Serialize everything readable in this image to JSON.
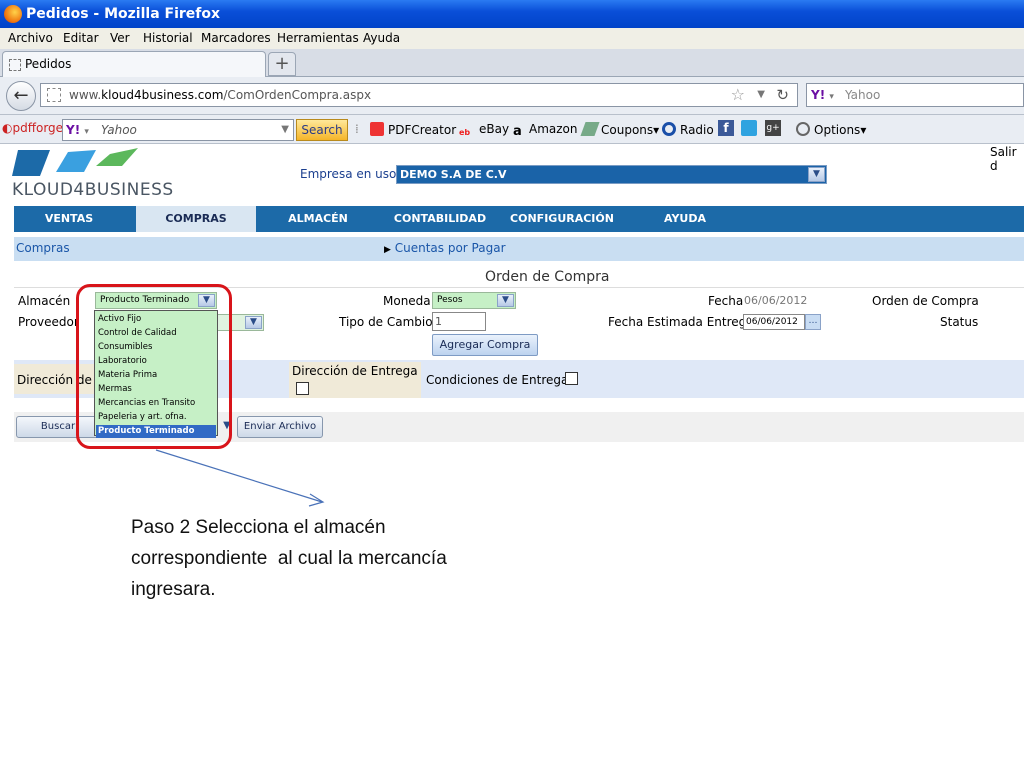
{
  "window": {
    "title": "Pedidos - Mozilla Firefox"
  },
  "menubar": {
    "items": [
      "Archivo",
      "Editar",
      "Ver",
      "Historial",
      "Marcadores",
      "Herramientas",
      "Ayuda"
    ]
  },
  "tabs": [
    {
      "label": "Pedidos"
    }
  ],
  "newtab": {
    "label": "+"
  },
  "navbar": {
    "back": "←",
    "url_prefix": "www.",
    "url_domain": "kloud4business.com",
    "url_path": "/ComOrdenCompra.aspx",
    "search_placeholder": "Yahoo",
    "search_engine": "Y!"
  },
  "toolbar2": {
    "pdfforge": "pdfforge",
    "yahoo_logo": "Y!",
    "yahoo_text": "Yahoo",
    "search_button": "Search",
    "items": [
      "PDFCreator",
      "eBay",
      "Amazon",
      "Coupons",
      "Radio",
      "Options"
    ]
  },
  "page": {
    "logo_text": "KLOUD4BUSINESS",
    "salir": "Salir d",
    "empresa_label": "Empresa en uso:",
    "empresa_value": "DEMO S.A DE C.V",
    "nav": [
      "VENTAS",
      "COMPRAS",
      "ALMACÉN",
      "CONTABILIDAD",
      "CONFIGURACIÓN",
      "AYUDA"
    ],
    "nav_active": "COMPRAS",
    "subnav_left": "Compras",
    "subnav_right": "Cuentas por Pagar",
    "form_title": "Orden de Compra",
    "form": {
      "almacen_label": "Almacén",
      "almacen_value": "Producto Terminado",
      "proveedor_label": "Proveedor",
      "moneda_label": "Moneda",
      "moneda_value": "Pesos",
      "tipo_cambio_label": "Tipo de Cambio",
      "tipo_cambio_value": "1",
      "agregar_button": "Agregar Compra",
      "fecha_label": "Fecha",
      "fecha_value": "06/06/2012",
      "fecha_estimada_label": "Fecha Estimada Entrega",
      "fecha_estimada_value": "06/06/2012",
      "orden_label": "Orden de Compra",
      "status_label": "Status",
      "direccion_label": "Dirección de",
      "direccion_entrega_label": "Dirección de Entrega",
      "condiciones_label": "Condiciones de Entrega"
    },
    "buttons": {
      "buscar": "Buscar",
      "enviar": "Enviar Archivo"
    },
    "dropdown_options": [
      "Activo Fijo",
      "Control de Calidad",
      "Consumibles",
      "Laboratorio",
      "Materia Prima",
      "Mermas",
      "Mercancias en Transito",
      "Papeleria y art. ofna.",
      "Producto Terminado"
    ],
    "dropdown_selected": "Producto Terminado"
  },
  "annotation": {
    "text": "Paso 2 Selecciona el almacén\ncorrespondiente  al cual la mercancía\ningresara."
  },
  "colors": {
    "titlebar": "#0a4fd8",
    "nav": "#1c6aa8",
    "subnav": "#c9def2",
    "highlight": "#d8141a",
    "dropdown_bg": "#c6f0c6",
    "selected": "#316ac5"
  }
}
